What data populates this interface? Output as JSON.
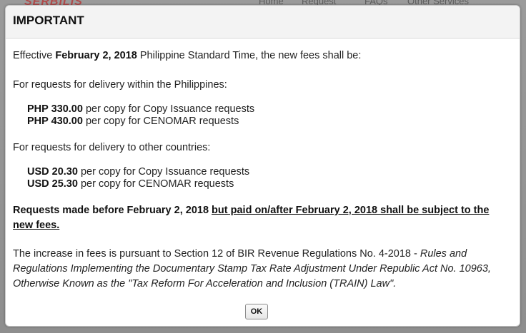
{
  "background": {
    "logo": "SERBILIS",
    "nav": [
      "Home",
      "Request",
      "FAQs",
      "Other Services"
    ]
  },
  "dialog": {
    "title": "IMPORTANT",
    "effective_prefix": "Effective ",
    "effective_date": "February 2, 2018",
    "effective_suffix": " Philippine Standard Time, the new fees shall be:",
    "domestic_heading": "For requests for delivery within the Philippines:",
    "domestic_fees": [
      {
        "amount": "PHP 330.00",
        "desc": " per copy for Copy Issuance requests"
      },
      {
        "amount": "PHP 430.00",
        "desc": " per copy for CENOMAR requests"
      }
    ],
    "foreign_heading": "For requests for delivery to other countries:",
    "foreign_fees": [
      {
        "amount": "USD 20.30",
        "desc": " per copy for Copy Issuance requests"
      },
      {
        "amount": "USD 25.30",
        "desc": " per copy for CENOMAR requests"
      }
    ],
    "notice_plain": "Requests made before February 2, 2018 ",
    "notice_underlined": "but paid on/after February 2, 2018 shall be subject to the new fees.",
    "basis_plain": "The increase in fees is pursuant to Section 12 of BIR Revenue Regulations No. 4-2018 - ",
    "basis_italic": "Rules and Regulations Implementing the Documentary Stamp Tax Rate Adjustment Under Republic Act No. 10963, Otherwise Known as the \"Tax Reform For Acceleration and Inclusion (TRAIN) Law\".",
    "ok_label": "OK"
  }
}
